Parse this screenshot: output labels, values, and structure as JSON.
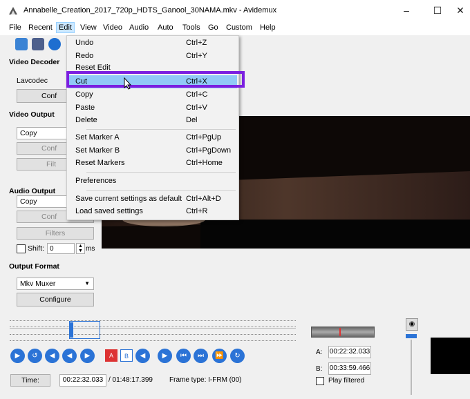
{
  "window": {
    "title": "Annabelle_Creation_2017_720p_HDTS_Ganool_30NAMA.mkv - Avidemux",
    "minimize": "–",
    "maximize": "☐",
    "close": "✕"
  },
  "menubar": [
    "File",
    "Recent",
    "Edit",
    "View",
    "Video",
    "Audio",
    "Auto",
    "Tools",
    "Go",
    "Custom",
    "Help"
  ],
  "edit_menu": {
    "groups": [
      [
        {
          "label": "Undo",
          "shortcut": "Ctrl+Z"
        },
        {
          "label": "Redo",
          "shortcut": "Ctrl+Y"
        },
        {
          "label": "Reset Edit",
          "shortcut": ""
        }
      ],
      [
        {
          "label": "Cut",
          "shortcut": "Ctrl+X"
        },
        {
          "label": "Copy",
          "shortcut": "Ctrl+C"
        },
        {
          "label": "Paste",
          "shortcut": "Ctrl+V"
        },
        {
          "label": "Delete",
          "shortcut": "Del"
        }
      ],
      [
        {
          "label": "Set Marker A",
          "shortcut": "Ctrl+PgUp"
        },
        {
          "label": "Set Marker B",
          "shortcut": "Ctrl+PgDown"
        },
        {
          "label": "Reset Markers",
          "shortcut": "Ctrl+Home"
        }
      ],
      [
        {
          "label": "Preferences",
          "shortcut": ""
        }
      ],
      [
        {
          "label": "Save current settings as default",
          "shortcut": "Ctrl+Alt+D"
        },
        {
          "label": "Load saved settings",
          "shortcut": "Ctrl+R"
        }
      ]
    ]
  },
  "left_panel": {
    "video_decoder": {
      "title": "Video Decoder",
      "codec": "Lavcodec",
      "configure": "Conf"
    },
    "video_output": {
      "title": "Video Output",
      "value": "Copy",
      "configure": "Conf",
      "filters": "Filt"
    },
    "audio_output": {
      "title": "Audio Output",
      "value": "Copy",
      "configure": "Conf",
      "filters": "Filters"
    },
    "shift": {
      "label": "Shift:",
      "value": "0",
      "unit": "ms"
    },
    "output_format": {
      "title": "Output Format",
      "value": "Mkv Muxer",
      "configure": "Configure"
    }
  },
  "status": {
    "time_button": "Time:",
    "current_time": "00:22:32.033",
    "duration": "/ 01:48:17.399",
    "frame_type": "Frame type: I-FRM (00)"
  },
  "markers": {
    "a_label": "A:",
    "a_value": "00:22:32.033",
    "b_label": "B:",
    "b_value": "00:33:59.466",
    "play_filtered": "Play filtered"
  },
  "transport_icons": [
    "play-icon",
    "rewind-icon",
    "back-one-icon",
    "back-keyframe-icon",
    "forward-one-icon",
    "marker-a-icon",
    "marker-b-icon",
    "prev-black-icon",
    "next-black-icon",
    "first-frame-icon",
    "last-frame-icon",
    "goto-time-icon",
    "goto-marker-icon"
  ],
  "colors": {
    "accent": "#2b73d6",
    "highlight": "#91c9f7",
    "annotation": "#7b1fe0"
  },
  "timeline_position": 0.208
}
